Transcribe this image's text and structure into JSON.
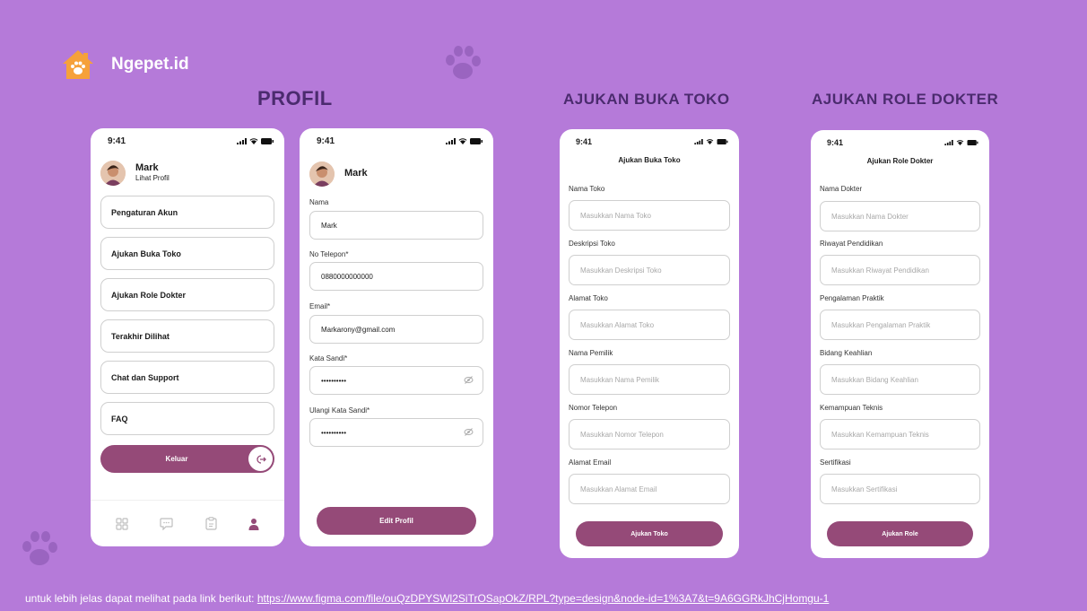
{
  "brand": {
    "name": "Ngepet.id"
  },
  "headings": {
    "profil": "PROFIL",
    "buka_toko": "AJUKAN BUKA TOKO",
    "role_dokter": "AJUKAN ROLE DOKTER"
  },
  "status": {
    "time": "9:41"
  },
  "profile_menu": {
    "user_name": "Mark",
    "user_sub": "Lihat Profil",
    "items": [
      "Pengaturan Akun",
      "Ajukan Buka Toko",
      "Ajukan Role Dokter",
      "Terakhir Dilihat",
      "Chat dan Support",
      "FAQ"
    ],
    "logout_label": "Keluar"
  },
  "edit_profile": {
    "user_name": "Mark",
    "fields": [
      {
        "label": "Nama",
        "value": "Mark"
      },
      {
        "label": "No Telepon*",
        "value": "0880000000000"
      },
      {
        "label": "Email*",
        "value": "Markarony@gmail.com"
      },
      {
        "label": "Kata Sandi*",
        "value": "••••••••••"
      },
      {
        "label": "Ulangi Kata Sandi*",
        "value": "••••••••••"
      }
    ],
    "button": "Edit Profil"
  },
  "buka_toko": {
    "title": "Ajukan Buka Toko",
    "fields": [
      {
        "label": "Nama Toko",
        "placeholder": "Masukkan Nama Toko"
      },
      {
        "label": "Deskripsi Toko",
        "placeholder": "Masukkan Deskripsi Toko"
      },
      {
        "label": "Alamat Toko",
        "placeholder": "Masukkan Alamat Toko"
      },
      {
        "label": "Nama Pemilik",
        "placeholder": "Masukkan Nama Pemilik"
      },
      {
        "label": "Nomor Telepon",
        "placeholder": "Masukkan Nomor Telepon"
      },
      {
        "label": "Alamat Email",
        "placeholder": "Masukkan Alamat Email"
      }
    ],
    "button": "Ajukan Toko"
  },
  "role_dokter": {
    "title": "Ajukan Role Dokter",
    "fields": [
      {
        "label": "Nama Dokter",
        "placeholder": "Masukkan Nama Dokter"
      },
      {
        "label": "Riwayat Pendidikan",
        "placeholder": "Masukkan Riwayat Pendidikan"
      },
      {
        "label": "Pengalaman Praktik",
        "placeholder": "Masukkan Pengalaman Praktik"
      },
      {
        "label": "Bidang Keahlian",
        "placeholder": "Masukkan Bidang Keahlian"
      },
      {
        "label": "Kemampuan Teknis",
        "placeholder": "Masukkan Kemampuan Teknis"
      },
      {
        "label": "Sertifikasi",
        "placeholder": "Masukkan Sertifikasi"
      }
    ],
    "button": "Ajukan Role"
  },
  "footer": {
    "text": "untuk lebih jelas dapat melihat pada link berikut: ",
    "link": "https://www.figma.com/file/ouQzDPYSWl2SiTrOSapOkZ/RPL?type=design&node-id=1%3A7&t=9A6GGRkJhCjHomgu-1"
  },
  "colors": {
    "background": "#b57ad9",
    "accent": "#954a78",
    "heading": "#4b2b6e",
    "logo": "#f6a13a"
  },
  "icons": [
    "house-paw-logo-icon",
    "paw-print-icon",
    "logout-icon",
    "grid-icon",
    "chat-icon",
    "clipboard-icon",
    "user-icon",
    "eye-off-icon",
    "signal-icon",
    "wifi-icon",
    "battery-icon"
  ]
}
